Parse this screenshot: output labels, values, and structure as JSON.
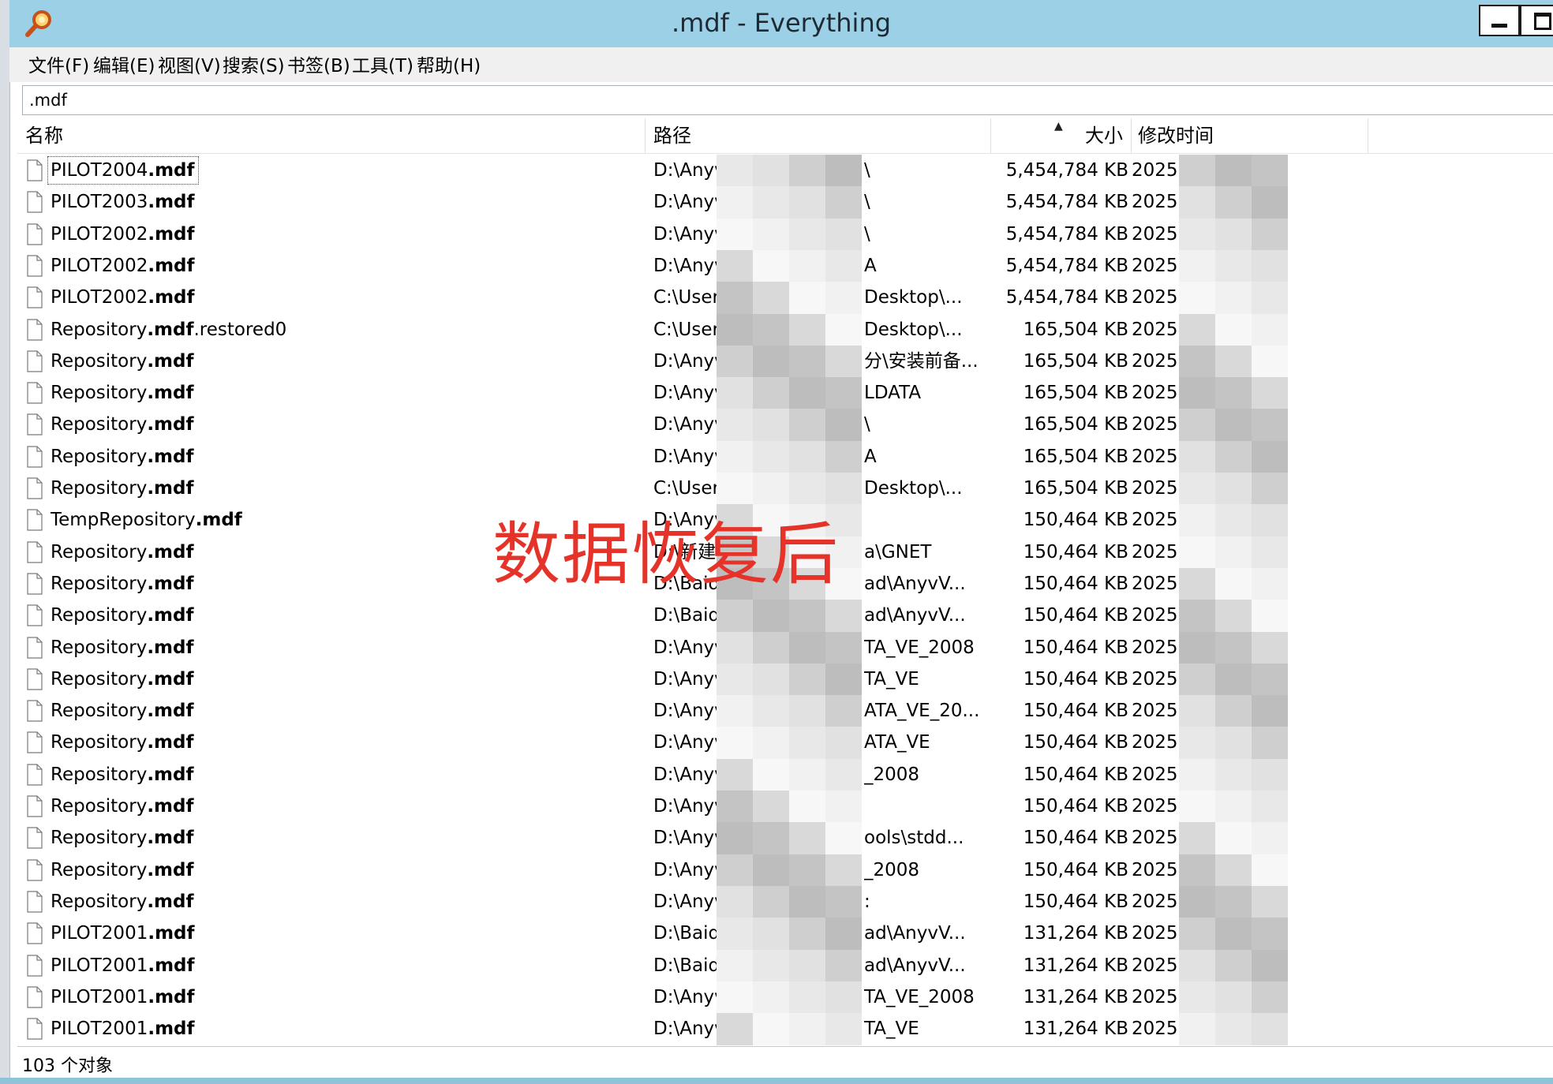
{
  "window": {
    "title": ".mdf - Everything",
    "icon": "magnifier-icon",
    "accent": "#9bd0e6"
  },
  "menu": [
    "文件(F)",
    "编辑(E)",
    "视图(V)",
    "搜索(S)",
    "书签(B)",
    "工具(T)",
    "帮助(H)"
  ],
  "search": {
    "value": ".mdf"
  },
  "columns": {
    "name": "名称",
    "path": "路径",
    "size": "大小",
    "date": "修改时间"
  },
  "rows": [
    {
      "name_pre": "PILOT2004",
      "name_match": ".mdf",
      "name_post": "",
      "path_a": "D:\\Anyv",
      "path_b": "\\",
      "size": "5,454,784 KB",
      "date": "2025"
    },
    {
      "name_pre": "PILOT2003",
      "name_match": ".mdf",
      "name_post": "",
      "path_a": "D:\\Anyv",
      "path_b": "\\",
      "size": "5,454,784 KB",
      "date": "2025"
    },
    {
      "name_pre": "PILOT2002",
      "name_match": ".mdf",
      "name_post": "",
      "path_a": "D:\\Anyv",
      "path_b": "\\",
      "size": "5,454,784 KB",
      "date": "2025"
    },
    {
      "name_pre": "PILOT2002",
      "name_match": ".mdf",
      "name_post": "",
      "path_a": "D:\\Anyv",
      "path_b": "A",
      "size": "5,454,784 KB",
      "date": "2025"
    },
    {
      "name_pre": "PILOT2002",
      "name_match": ".mdf",
      "name_post": "",
      "path_a": "C:\\User",
      "path_b": "Desktop\\...",
      "size": "5,454,784 KB",
      "date": "2025"
    },
    {
      "name_pre": "Repository",
      "name_match": ".mdf",
      "name_post": ".restored0",
      "path_a": "C:\\User",
      "path_b": "Desktop\\...",
      "size": "165,504 KB",
      "date": "2025"
    },
    {
      "name_pre": "Repository",
      "name_match": ".mdf",
      "name_post": "",
      "path_a": "D:\\Anyv",
      "path_b": "分\\安装前备...",
      "size": "165,504 KB",
      "date": "2025"
    },
    {
      "name_pre": "Repository",
      "name_match": ".mdf",
      "name_post": "",
      "path_a": "D:\\Anyv",
      "path_b": "LDATA",
      "size": "165,504 KB",
      "date": "2025"
    },
    {
      "name_pre": "Repository",
      "name_match": ".mdf",
      "name_post": "",
      "path_a": "D:\\Anyv",
      "path_b": "\\",
      "size": "165,504 KB",
      "date": "2025"
    },
    {
      "name_pre": "Repository",
      "name_match": ".mdf",
      "name_post": "",
      "path_a": "D:\\Anyv",
      "path_b": "A",
      "size": "165,504 KB",
      "date": "2025"
    },
    {
      "name_pre": "Repository",
      "name_match": ".mdf",
      "name_post": "",
      "path_a": "C:\\User",
      "path_b": "Desktop\\...",
      "size": "165,504 KB",
      "date": "2025"
    },
    {
      "name_pre": "TempRepository",
      "name_match": ".mdf",
      "name_post": "",
      "path_a": "D:\\Anyv",
      "path_b": "",
      "size": "150,464 KB",
      "date": "2025"
    },
    {
      "name_pre": "Repository",
      "name_match": ".mdf",
      "name_post": "",
      "path_a": "D:\\新建",
      "path_b": "a\\GNET",
      "size": "150,464 KB",
      "date": "2025"
    },
    {
      "name_pre": "Repository",
      "name_match": ".mdf",
      "name_post": "",
      "path_a": "D:\\Baid",
      "path_b": "ad\\AnyvV...",
      "size": "150,464 KB",
      "date": "2025"
    },
    {
      "name_pre": "Repository",
      "name_match": ".mdf",
      "name_post": "",
      "path_a": "D:\\Baid",
      "path_b": "ad\\AnyvV...",
      "size": "150,464 KB",
      "date": "2025"
    },
    {
      "name_pre": "Repository",
      "name_match": ".mdf",
      "name_post": "",
      "path_a": "D:\\Anyv",
      "path_b": "TA_VE_2008",
      "size": "150,464 KB",
      "date": "2025"
    },
    {
      "name_pre": "Repository",
      "name_match": ".mdf",
      "name_post": "",
      "path_a": "D:\\Anyv",
      "path_b": "TA_VE",
      "size": "150,464 KB",
      "date": "2025"
    },
    {
      "name_pre": "Repository",
      "name_match": ".mdf",
      "name_post": "",
      "path_a": "D:\\Anyv",
      "path_b": "ATA_VE_20...",
      "size": "150,464 KB",
      "date": "2025"
    },
    {
      "name_pre": "Repository",
      "name_match": ".mdf",
      "name_post": "",
      "path_a": "D:\\Anyv",
      "path_b": "ATA_VE",
      "size": "150,464 KB",
      "date": "2025"
    },
    {
      "name_pre": "Repository",
      "name_match": ".mdf",
      "name_post": "",
      "path_a": "D:\\Anyv",
      "path_b": "_2008",
      "size": "150,464 KB",
      "date": "2025"
    },
    {
      "name_pre": "Repository",
      "name_match": ".mdf",
      "name_post": "",
      "path_a": "D:\\Anyv",
      "path_b": "",
      "size": "150,464 KB",
      "date": "2025"
    },
    {
      "name_pre": "Repository",
      "name_match": ".mdf",
      "name_post": "",
      "path_a": "D:\\Anyv",
      "path_b": "ools\\stdd...",
      "size": "150,464 KB",
      "date": "2025"
    },
    {
      "name_pre": "Repository",
      "name_match": ".mdf",
      "name_post": "",
      "path_a": "D:\\Anyv",
      "path_b": "_2008",
      "size": "150,464 KB",
      "date": "2025"
    },
    {
      "name_pre": "Repository",
      "name_match": ".mdf",
      "name_post": "",
      "path_a": "D:\\Anyv",
      "path_b": ":",
      "size": "150,464 KB",
      "date": "2025"
    },
    {
      "name_pre": "PILOT2001",
      "name_match": ".mdf",
      "name_post": "",
      "path_a": "D:\\Baid",
      "path_b": "ad\\AnyvV...",
      "size": "131,264 KB",
      "date": "2025"
    },
    {
      "name_pre": "PILOT2001",
      "name_match": ".mdf",
      "name_post": "",
      "path_a": "D:\\Baid",
      "path_b": "ad\\AnyvV...",
      "size": "131,264 KB",
      "date": "2025"
    },
    {
      "name_pre": "PILOT2001",
      "name_match": ".mdf",
      "name_post": "",
      "path_a": "D:\\Anyv",
      "path_b": "TA_VE_2008",
      "size": "131,264 KB",
      "date": "2025"
    },
    {
      "name_pre": "PILOT2001",
      "name_match": ".mdf",
      "name_post": "",
      "path_a": "D:\\Anyv",
      "path_b": "TA_VE",
      "size": "131,264 KB",
      "date": "2025"
    }
  ],
  "overlay_text": "数据恢复后",
  "status": "103 个对象"
}
